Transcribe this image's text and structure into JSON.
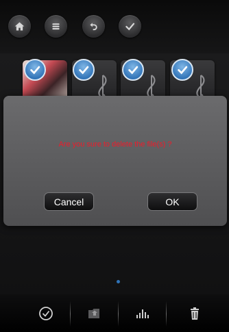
{
  "toolbar": {
    "buttons": [
      {
        "icon": "home-icon"
      },
      {
        "icon": "menu-icon"
      },
      {
        "icon": "back-icon"
      },
      {
        "icon": "checkmark-icon"
      }
    ]
  },
  "gallery": {
    "items": [
      {
        "type": "photo",
        "selected": true
      },
      {
        "type": "music",
        "selected": true
      },
      {
        "type": "music",
        "selected": true
      },
      {
        "type": "music",
        "selected": true
      }
    ],
    "page_indicator": {
      "pages": 1,
      "current": 1
    }
  },
  "dialog": {
    "message": "Are you sure to delete the file(s) ?",
    "cancel_label": "Cancel",
    "ok_label": "OK",
    "message_color": "#ee1c2b"
  },
  "bottom_bar": {
    "buttons": [
      {
        "icon": "select-all-icon"
      },
      {
        "icon": "move-folder-icon"
      },
      {
        "icon": "equalizer-icon"
      },
      {
        "icon": "trash-icon"
      }
    ]
  },
  "colors": {
    "accent": "#2f73b8",
    "background": "#1a1a1b"
  }
}
